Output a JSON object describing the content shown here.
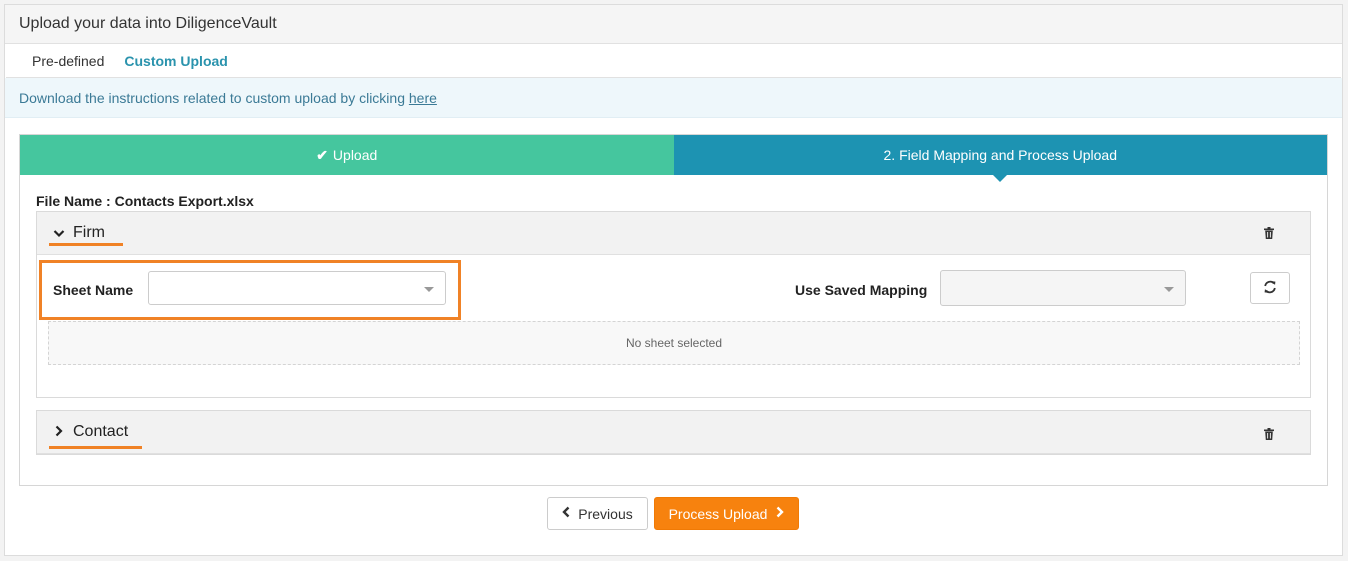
{
  "header": {
    "title": "Upload your data into DiligenceVault"
  },
  "tabs": [
    {
      "label": "Pre-defined",
      "active": false
    },
    {
      "label": "Custom Upload",
      "active": true
    }
  ],
  "info": {
    "text": "Download the instructions related to custom upload by clicking",
    "link": "here"
  },
  "steps": [
    {
      "label": "Upload",
      "status": "done"
    },
    {
      "label": "2. Field Mapping and Process Upload",
      "status": "current"
    }
  ],
  "file": {
    "label": "File Name : Contacts Export.xlsx"
  },
  "sections": {
    "firm": {
      "title": "Firm",
      "expanded": true
    },
    "contact": {
      "title": "Contact",
      "expanded": false
    }
  },
  "form": {
    "sheet_label": "Sheet Name",
    "sheet_value": "",
    "mapping_label": "Use Saved Mapping",
    "mapping_value": "",
    "empty_text": "No sheet selected"
  },
  "buttons": {
    "previous": "Previous",
    "process": "Process Upload"
  },
  "colors": {
    "accent_teal": "#1d93b2",
    "step_done": "#45c69e",
    "highlight_orange": "#f08226",
    "button_orange": "#f7820e",
    "active_tab": "#2a93ad"
  },
  "icons": {
    "check": "check-icon",
    "chevron_down": "chevron-down-icon",
    "chevron_right": "chevron-right-icon",
    "trash": "trash-icon",
    "refresh": "refresh-icon",
    "prev": "chevron-left-icon",
    "next": "chevron-right-icon"
  }
}
